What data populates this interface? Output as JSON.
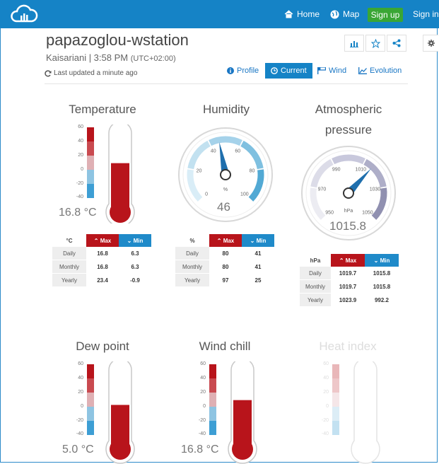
{
  "nav": {
    "home": "Home",
    "map": "Map",
    "signup": "Sign up",
    "signin": "Sign in"
  },
  "station": {
    "name": "papazoglou-wstation",
    "location": "Kaisariani | 3:58 PM",
    "timezone": "(UTC+02:00)",
    "updated": "Last updated a minute ago"
  },
  "tabs": {
    "profile": "Profile",
    "current": "Current",
    "wind": "Wind",
    "evolution": "Evolution"
  },
  "temperature": {
    "title": "Temperature",
    "value": "16.8 °C",
    "fill": 0.605,
    "ticks": [
      "60",
      "40",
      "20",
      "0",
      "-20",
      "-40"
    ],
    "unit": "°C",
    "max_label": "Max",
    "min_label": "Min",
    "rows": [
      {
        "label": "Daily",
        "max": "16.8",
        "min": "6.3"
      },
      {
        "label": "Monthly",
        "max": "16.8",
        "min": "6.3"
      },
      {
        "label": "Yearly",
        "max": "23.4",
        "min": "-0.9"
      }
    ]
  },
  "humidity": {
    "title": "Humidity",
    "value": "46",
    "unit_label": "%",
    "ticks": [
      "0",
      "20",
      "40",
      "60",
      "80",
      "100"
    ],
    "unit": "%",
    "max_label": "Max",
    "min_label": "Min",
    "rows": [
      {
        "label": "Daily",
        "max": "80",
        "min": "41"
      },
      {
        "label": "Monthly",
        "max": "80",
        "min": "41"
      },
      {
        "label": "Yearly",
        "max": "97",
        "min": "25"
      }
    ]
  },
  "pressure": {
    "title_line1": "Atmospheric",
    "title_line2": "pressure",
    "value": "1015.8",
    "unit_label": "hPa",
    "ticks": [
      "950",
      "970",
      "990",
      "1010",
      "1030",
      "1050"
    ],
    "unit": "hPa",
    "max_label": "Max",
    "min_label": "Min",
    "rows": [
      {
        "label": "Daily",
        "max": "1019.7",
        "min": "1015.8"
      },
      {
        "label": "Monthly",
        "max": "1019.7",
        "min": "1015.8"
      },
      {
        "label": "Yearly",
        "max": "1023.9",
        "min": "992.2"
      }
    ]
  },
  "dewpoint": {
    "title": "Dew point",
    "value": "5.0 °C",
    "fill": 0.542,
    "ticks": [
      "60",
      "40",
      "20",
      "0",
      "-20",
      "-40"
    ]
  },
  "windchill": {
    "title": "Wind chill",
    "value": "16.8 °C",
    "fill": 0.605,
    "ticks": [
      "60",
      "40",
      "20",
      "0",
      "-20",
      "-40"
    ]
  },
  "heatindex": {
    "title": "Heat index",
    "ticks": [
      "60",
      "40",
      "20",
      "0",
      "-20",
      "-40"
    ]
  },
  "colors": {
    "brand": "#1583c6",
    "max": "#b8141b",
    "min": "#1f8ac9",
    "signup": "#3aa635"
  }
}
